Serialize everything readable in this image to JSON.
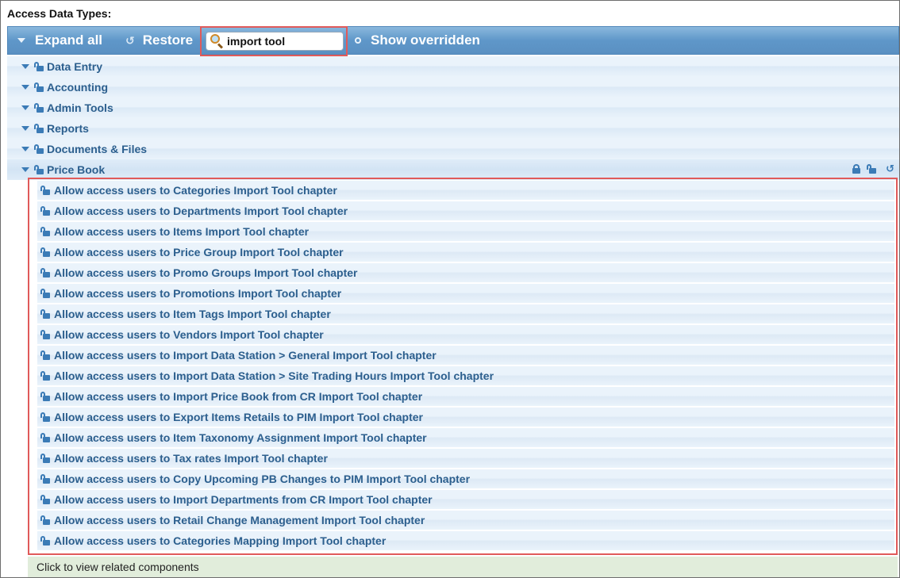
{
  "page": {
    "title": "Access Data Types:"
  },
  "toolbar": {
    "expand_all": "Expand all",
    "restore": "Restore",
    "search_value": "import tool",
    "show_overridden": "Show overridden"
  },
  "tree": {
    "categories": [
      {
        "label": "Data Entry"
      },
      {
        "label": "Accounting"
      },
      {
        "label": "Admin Tools"
      },
      {
        "label": "Reports"
      },
      {
        "label": "Documents & Files"
      },
      {
        "label": "Price Book"
      }
    ],
    "price_book_children": [
      {
        "label": "Allow access users to Categories Import Tool chapter"
      },
      {
        "label": "Allow access users to Departments Import Tool chapter"
      },
      {
        "label": "Allow access users to Items Import Tool chapter"
      },
      {
        "label": "Allow access users to Price Group Import Tool chapter"
      },
      {
        "label": "Allow access users to Promo Groups Import Tool chapter"
      },
      {
        "label": "Allow access users to Promotions Import Tool chapter"
      },
      {
        "label": "Allow access users to Item Tags Import Tool chapter"
      },
      {
        "label": "Allow access users to Vendors Import Tool chapter"
      },
      {
        "label": "Allow access users to Import Data Station > General Import Tool chapter"
      },
      {
        "label": "Allow access users to Import Data Station > Site Trading Hours Import Tool chapter"
      },
      {
        "label": "Allow access users to Import Price Book from CR Import Tool chapter"
      },
      {
        "label": "Allow access users to Export Items Retails to PIM Import Tool chapter"
      },
      {
        "label": "Allow access users to Item Taxonomy Assignment Import Tool chapter"
      },
      {
        "label": "Allow access users to Tax rates Import Tool chapter"
      },
      {
        "label": "Allow access users to Copy Upcoming PB Changes to PIM Import Tool chapter"
      },
      {
        "label": "Allow access users to Import Departments from CR Import Tool chapter"
      },
      {
        "label": "Allow access users to Retail Change Management Import Tool chapter"
      },
      {
        "label": "Allow access users to Categories Mapping Import Tool chapter"
      }
    ]
  },
  "footer": {
    "text": "Click to view related components"
  },
  "colors": {
    "accent": "#5f97c9",
    "highlight": "#e05a5a",
    "link": "#2c5f8e",
    "footer_bg": "#e1eddb"
  }
}
